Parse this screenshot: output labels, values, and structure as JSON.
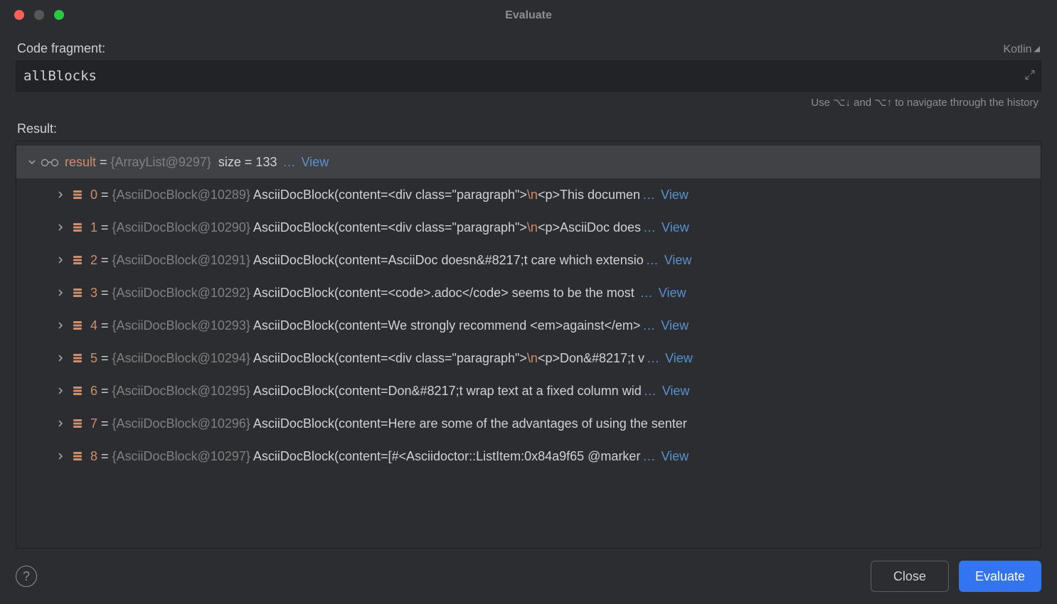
{
  "title": "Evaluate",
  "code_fragment_label": "Code fragment:",
  "language": "Kotlin",
  "code_value": "allBlocks",
  "hint": "Use ⌥↓ and ⌥↑ to navigate through the history",
  "result_label": "Result:",
  "result_row": {
    "name": "result",
    "eq": " = ",
    "type": "{ArrayList@9297}",
    "size": "size = 133",
    "view": "View"
  },
  "items": [
    {
      "idx": "0",
      "type": "{AsciiDocBlock@10289}",
      "pre": "AsciiDocBlock(content=<div class=\"paragraph\">",
      "esc": "\\n",
      "post": "<p>This documen",
      "view": true
    },
    {
      "idx": "1",
      "type": "{AsciiDocBlock@10290}",
      "pre": "AsciiDocBlock(content=<div class=\"paragraph\">",
      "esc": "\\n",
      "post": "<p>AsciiDoc does",
      "view": true
    },
    {
      "idx": "2",
      "type": "{AsciiDocBlock@10291}",
      "pre": "AsciiDocBlock(content=AsciiDoc doesn&#8217;t care which extensio",
      "esc": "",
      "post": "",
      "view": true
    },
    {
      "idx": "3",
      "type": "{AsciiDocBlock@10292}",
      "pre": "AsciiDocBlock(content=<code>.adoc</code> seems to be the most ",
      "esc": "",
      "post": "",
      "view": true
    },
    {
      "idx": "4",
      "type": "{AsciiDocBlock@10293}",
      "pre": "AsciiDocBlock(content=We strongly recommend <em>against</em>",
      "esc": "",
      "post": "",
      "view": true
    },
    {
      "idx": "5",
      "type": "{AsciiDocBlock@10294}",
      "pre": "AsciiDocBlock(content=<div class=\"paragraph\">",
      "esc": "\\n",
      "post": "<p>Don&#8217;t v",
      "view": true
    },
    {
      "idx": "6",
      "type": "{AsciiDocBlock@10295}",
      "pre": "AsciiDocBlock(content=Don&#8217;t wrap text at a fixed column wid",
      "esc": "",
      "post": "",
      "view": true
    },
    {
      "idx": "7",
      "type": "{AsciiDocBlock@10296}",
      "pre": "AsciiDocBlock(content=Here are some of the advantages of using the senter",
      "esc": "",
      "post": "",
      "view": false
    },
    {
      "idx": "8",
      "type": "{AsciiDocBlock@10297}",
      "pre": "AsciiDocBlock(content=[#<Asciidoctor::ListItem:0x84a9f65 @marker",
      "esc": "",
      "post": "",
      "view": true
    }
  ],
  "footer": {
    "close": "Close",
    "evaluate": "Evaluate"
  },
  "view_label": "View",
  "ellipsis": "…"
}
